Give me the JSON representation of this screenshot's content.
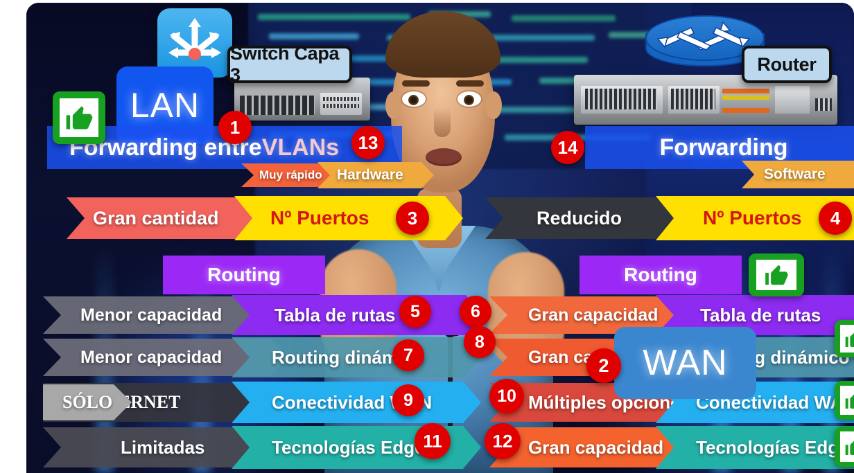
{
  "scene": {
    "kind": "video-frame-screenshot",
    "topic": "Switch Capa 3 vs Router"
  },
  "left_column": {
    "device_tag": "Switch Capa 3",
    "device_icon": "layer3-switch-icon",
    "scope_badge": "LAN",
    "banner": {
      "text_plain": "Forwarding entre ",
      "text_highlight": "VLANs",
      "full": "Forwarding entre VLANs"
    },
    "speed_chevrons": [
      {
        "label": "Muy rápido",
        "color": "#f4623a"
      },
      {
        "label": "Hardware",
        "color": "#f0a93c"
      }
    ],
    "thumb_up": "thumbs-up-icon"
  },
  "right_column": {
    "device_tag": "Router",
    "device_icon": "router-icon",
    "scope_badge": "WAN",
    "banner": {
      "full": "Forwarding"
    },
    "speed_chevrons": [
      {
        "label": "Software",
        "color": "#f0a93c"
      }
    ]
  },
  "comparison_rows": [
    {
      "left": {
        "value": "Gran cantidad",
        "value_color": "#f2635c",
        "feature": "Nº Puertos",
        "feature_bg": "#ffe000",
        "feature_color": "#d41616",
        "number": "3"
      },
      "right": {
        "value": "Reducido",
        "value_color": "#33363d",
        "feature": "Nº Puertos",
        "feature_bg": "#ffe000",
        "feature_color": "#d41616",
        "number": "4"
      }
    },
    {
      "left": {
        "value": "Menor capacidad",
        "value_color": "#6e6e7a",
        "feature": "Tabla de rutas",
        "feature_bg": "#8d2bf0",
        "feature_color": "#ffffff",
        "number": "5"
      },
      "right": {
        "value": "Gran capacidad",
        "value_color": "#f0683c",
        "feature": "Tabla de rutas",
        "feature_bg": "#8d2bf0",
        "feature_color": "#ffffff",
        "number": "6",
        "thumb": true
      }
    },
    {
      "left": {
        "value": "Menor capacidad",
        "value_color": "#6e6e7a",
        "feature": "Routing dinámico",
        "feature_bg": "#4f97ac",
        "feature_color": "#ffffff",
        "number": "7"
      },
      "right": {
        "value": "Gran capacidad",
        "value_color": "#ef5a30",
        "feature": "Routing dinámico",
        "feature_bg": "#4f97ac",
        "feature_color": "#ffffff",
        "number": "8",
        "thumb": true
      }
    },
    {
      "left": {
        "value": "SÓLO ETHERNET",
        "value_color": "#35363c",
        "feature": "Conectividad WAN",
        "feature_bg": "#24b0f0",
        "feature_color": "#ffffff",
        "number": "9"
      },
      "right": {
        "value": "Múltiples opciones",
        "value_color": "#d8483c",
        "feature": "Conectividad WAN",
        "feature_bg": "#24b0f0",
        "feature_color": "#ffffff",
        "number": "10",
        "thumb": true
      }
    },
    {
      "left": {
        "value": "Limitadas",
        "value_color": "#4a4b53",
        "feature": "Tecnologías Edge",
        "feature_bg": "#23b0a6",
        "feature_color": "#ffffff",
        "number": "11"
      },
      "right": {
        "value": "Gran capacidad",
        "value_color": "#f4622e",
        "feature": "Tecnologías Edge",
        "feature_bg": "#23b0a6",
        "feature_color": "#ffffff",
        "number": "12",
        "thumb": true
      }
    }
  ],
  "routing_labels": {
    "left": "Routing",
    "right": "Routing",
    "bg": "#9b28f5"
  },
  "solo_badge": {
    "label": "SÓLO",
    "rest": "ETHERNET"
  },
  "top_numbers": {
    "switch_port": "1",
    "wan_badge": "2",
    "left_speed": "13",
    "right_speed": "14"
  },
  "colors": {
    "red_marker": "#e00000",
    "green_thumb": "#18a020",
    "lan_blue": "#1256f0",
    "wan_blue": "#3a86cf",
    "banner_blue": "#1b49f0"
  }
}
